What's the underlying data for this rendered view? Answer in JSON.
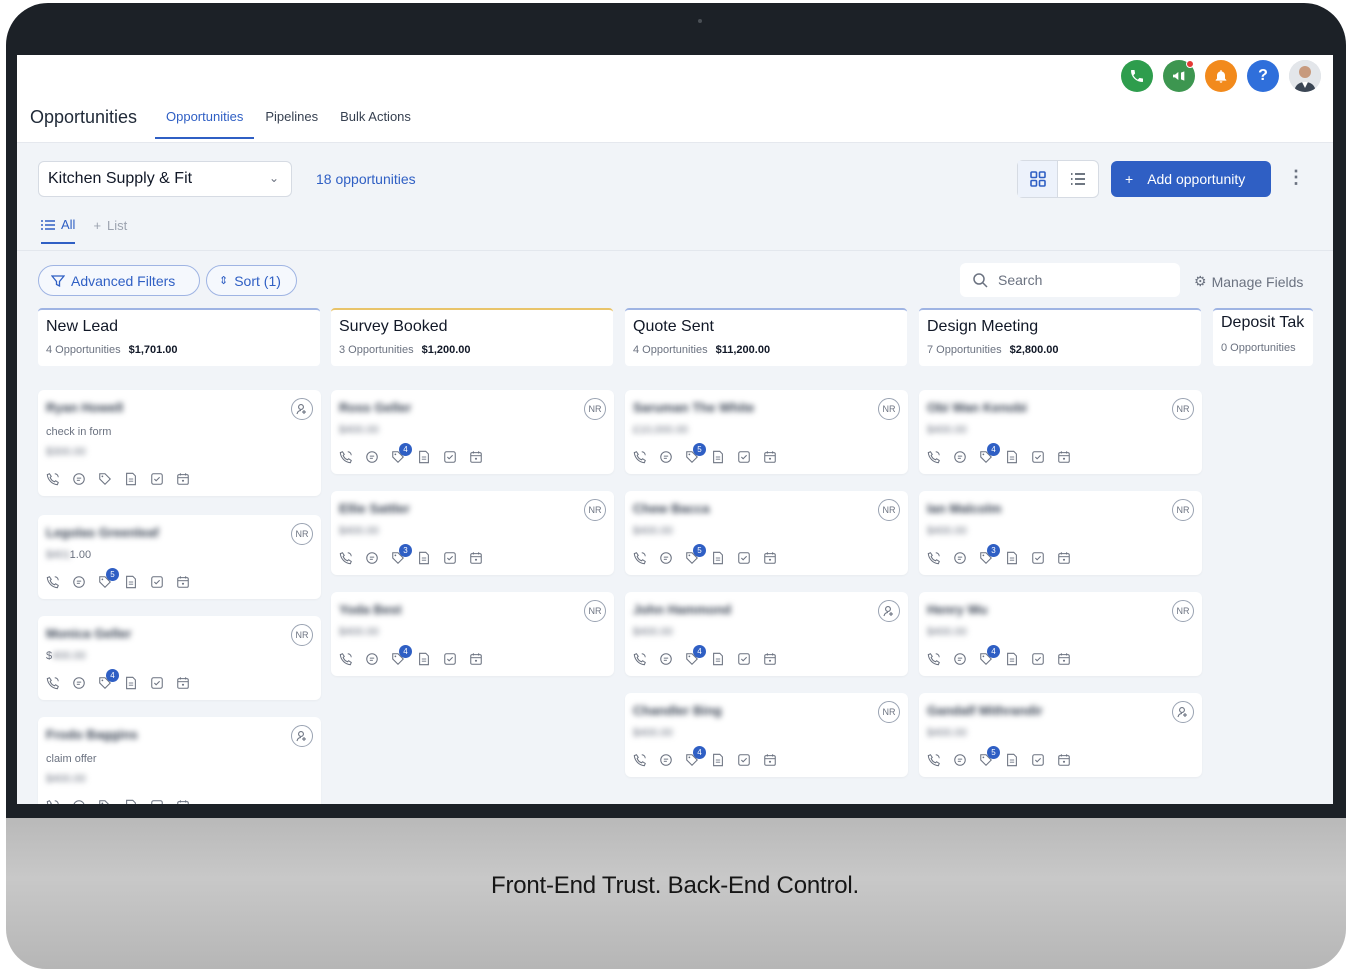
{
  "tagline": "Front-End Trust. Back-End Control.",
  "header": {
    "app_title": "Opportunities",
    "tabs": [
      "Opportunities",
      "Pipelines",
      "Bulk Actions"
    ],
    "icons": {
      "phone": {
        "icon": "phone-icon",
        "color": "#2e9d4d"
      },
      "announce": {
        "icon": "megaphone-icon",
        "color": "#3d9650"
      },
      "notify": {
        "icon": "bell-icon",
        "color": "#f28a1c"
      },
      "help": {
        "icon": "help-icon",
        "color": "#2f6fdb",
        "glyph": "?"
      }
    }
  },
  "toolbar": {
    "pipeline": "Kitchen Supply & Fit",
    "count": "18 opportunities",
    "add_label": "Add opportunity",
    "tab_all": "All",
    "tab_list": "List",
    "advanced_filters": "Advanced Filters",
    "sort": "Sort (1)",
    "search_placeholder": "Search",
    "manage_fields": "Manage Fields"
  },
  "accent_color": "#2f5fc4",
  "columns": [
    {
      "name": "New Lead",
      "count": "4 Opportunities",
      "total": "$1,701.00",
      "cards": [
        {
          "name": "Ryan Howell",
          "note": "check in form",
          "value": "$300.00",
          "value_prefix": "",
          "badge": "assign",
          "count": ""
        },
        {
          "name": "Legolas Greenleaf",
          "note": "",
          "value": "$401",
          "value_prefix": "",
          "value_suffix": "1.00",
          "badge": "NR",
          "count": "5"
        },
        {
          "name": "Monica Geller",
          "note": "",
          "value": "400.00",
          "value_prefix": "$",
          "badge": "NR",
          "count": "4"
        },
        {
          "name": "Frodo Baggins",
          "note": "claim offer",
          "value": "$400.00",
          "value_prefix": "",
          "badge": "assign",
          "count": ""
        }
      ]
    },
    {
      "name": "Survey Booked",
      "count": "3 Opportunities",
      "total": "$1,200.00",
      "cards": [
        {
          "name": "Ross Geller",
          "value": "$400.00",
          "badge": "NR",
          "count": "4"
        },
        {
          "name": "Ellie Sattler",
          "value": "$400.00",
          "badge": "NR",
          "count": "3"
        },
        {
          "name": "Yoda Best",
          "value": "$400.00",
          "badge": "NR",
          "count": "4"
        }
      ]
    },
    {
      "name": "Quote Sent",
      "count": "4 Opportunities",
      "total": "$11,200.00",
      "cards": [
        {
          "name": "Saruman The White",
          "value": "£10,000.00",
          "badge": "NR",
          "count": "5"
        },
        {
          "name": "Chew Bacca",
          "value": "$400.00",
          "badge": "NR",
          "count": "5"
        },
        {
          "name": "John Hammond",
          "value": "$400.00",
          "badge": "assign",
          "count": "4"
        },
        {
          "name": "Chandler Bing",
          "value": "$400.00",
          "badge": "NR",
          "count": "4"
        }
      ]
    },
    {
      "name": "Design Meeting",
      "count": "7 Opportunities",
      "total": "$2,800.00",
      "cards": [
        {
          "name": "Obi Wan Kenobi",
          "value": "$400.00",
          "badge": "NR",
          "count": "4"
        },
        {
          "name": "Ian Malcolm",
          "value": "$400.00",
          "badge": "NR",
          "count": "3"
        },
        {
          "name": "Henry Wu",
          "value": "$400.00",
          "badge": "NR",
          "count": "4"
        },
        {
          "name": "Gandalf Mithrandir",
          "value": "$400.00",
          "badge": "assign",
          "count": "5"
        }
      ]
    },
    {
      "name": "Deposit Tak",
      "count": "0 Opportunities",
      "total": "",
      "cards": []
    }
  ]
}
